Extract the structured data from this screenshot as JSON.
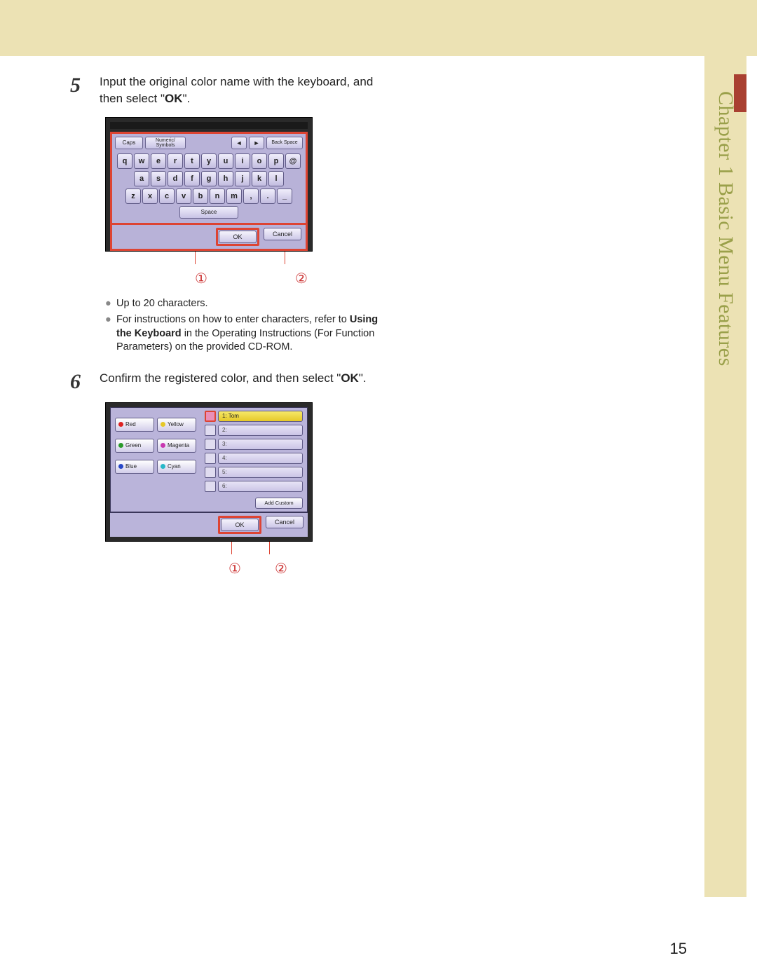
{
  "side": {
    "label": "Chapter 1   Basic Menu Features"
  },
  "page_number": "15",
  "steps": {
    "s5": {
      "num": "5",
      "text_a": "Input the original color name with the keyboard, and then select \"",
      "bold": "OK",
      "text_b": "\"."
    },
    "s6": {
      "num": "6",
      "text_a": "Confirm the registered color, and then select \"",
      "bold": "OK",
      "text_b": "\"."
    }
  },
  "notes": {
    "n1": "Up to 20 characters.",
    "n2_a": "For instructions on how to enter characters, refer to ",
    "n2_bold": "Using the Keyboard",
    "n2_b": " in the Operating Instructions (For Function Parameters) on the provided CD-ROM."
  },
  "circled": {
    "c1": "①",
    "c2": "②"
  },
  "kbd": {
    "caps": "Caps",
    "mode": "Numeric/\nSymbols",
    "back": "Back Space",
    "arrow_l": "◄",
    "arrow_r": "►",
    "row1": [
      "q",
      "w",
      "e",
      "r",
      "t",
      "y",
      "u",
      "i",
      "o",
      "p",
      "@"
    ],
    "row2": [
      "a",
      "s",
      "d",
      "f",
      "g",
      "h",
      "j",
      "k",
      "l"
    ],
    "row3": [
      "z",
      "x",
      "c",
      "v",
      "b",
      "n",
      "m",
      ",",
      ".",
      "_"
    ],
    "space": "Space",
    "ok": "OK",
    "cancel": "Cancel"
  },
  "color": {
    "left": [
      [
        {
          "dot": "red",
          "label": "Red"
        },
        {
          "dot": "yellow",
          "label": "Yellow"
        }
      ],
      [
        {
          "dot": "green",
          "label": "Green"
        },
        {
          "dot": "magenta",
          "label": "Magenta"
        }
      ],
      [
        {
          "dot": "blue",
          "label": "Blue"
        },
        {
          "dot": "cyan",
          "label": "Cyan"
        }
      ]
    ],
    "slot1": "1: Tom",
    "slot_nums": [
      "2:",
      "3:",
      "4:",
      "5:",
      "6:"
    ],
    "add_custom": "Add Custom",
    "ok": "OK",
    "cancel": "Cancel"
  }
}
